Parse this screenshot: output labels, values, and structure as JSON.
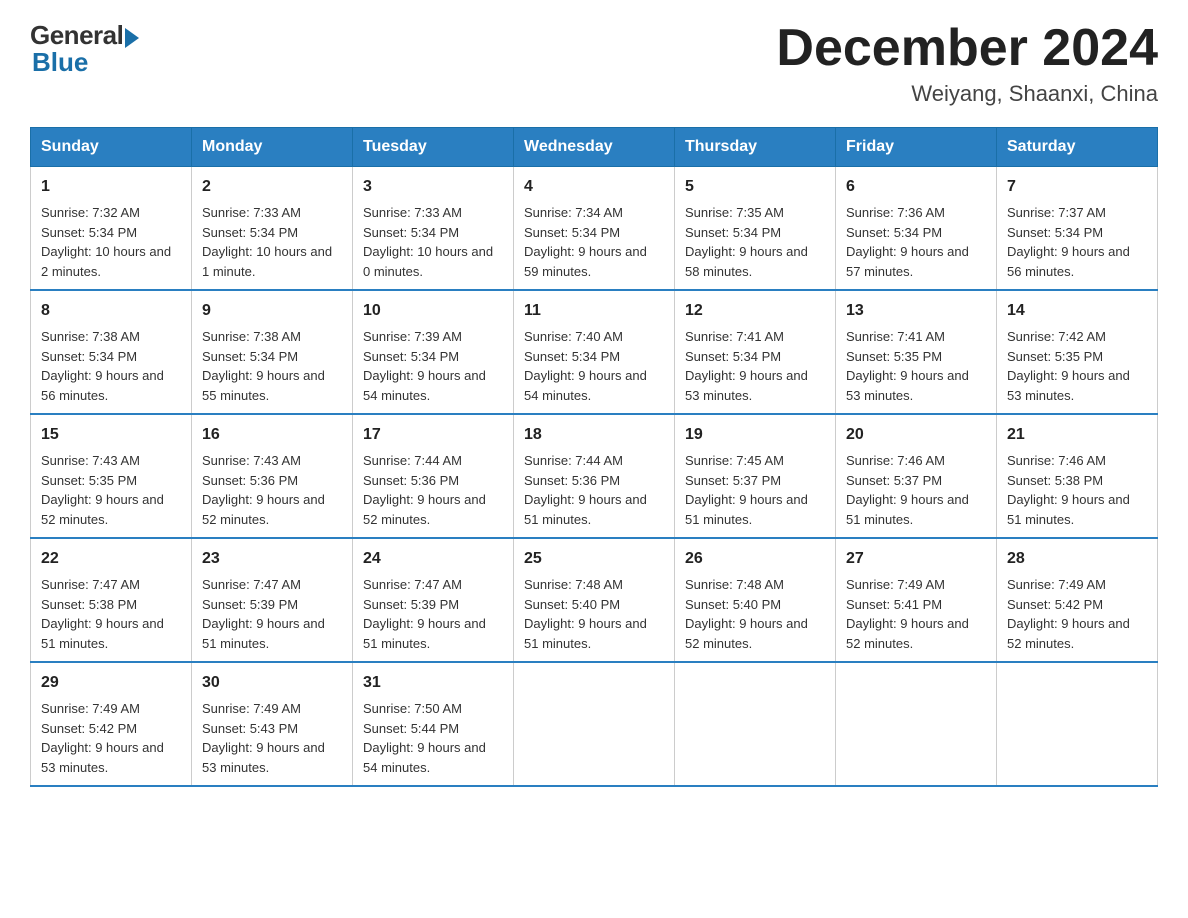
{
  "logo": {
    "general": "General",
    "blue": "Blue"
  },
  "title": "December 2024",
  "location": "Weiyang, Shaanxi, China",
  "weekdays": [
    "Sunday",
    "Monday",
    "Tuesday",
    "Wednesday",
    "Thursday",
    "Friday",
    "Saturday"
  ],
  "weeks": [
    [
      {
        "day": "1",
        "sunrise": "7:32 AM",
        "sunset": "5:34 PM",
        "daylight": "10 hours and 2 minutes."
      },
      {
        "day": "2",
        "sunrise": "7:33 AM",
        "sunset": "5:34 PM",
        "daylight": "10 hours and 1 minute."
      },
      {
        "day": "3",
        "sunrise": "7:33 AM",
        "sunset": "5:34 PM",
        "daylight": "10 hours and 0 minutes."
      },
      {
        "day": "4",
        "sunrise": "7:34 AM",
        "sunset": "5:34 PM",
        "daylight": "9 hours and 59 minutes."
      },
      {
        "day": "5",
        "sunrise": "7:35 AM",
        "sunset": "5:34 PM",
        "daylight": "9 hours and 58 minutes."
      },
      {
        "day": "6",
        "sunrise": "7:36 AM",
        "sunset": "5:34 PM",
        "daylight": "9 hours and 57 minutes."
      },
      {
        "day": "7",
        "sunrise": "7:37 AM",
        "sunset": "5:34 PM",
        "daylight": "9 hours and 56 minutes."
      }
    ],
    [
      {
        "day": "8",
        "sunrise": "7:38 AM",
        "sunset": "5:34 PM",
        "daylight": "9 hours and 56 minutes."
      },
      {
        "day": "9",
        "sunrise": "7:38 AM",
        "sunset": "5:34 PM",
        "daylight": "9 hours and 55 minutes."
      },
      {
        "day": "10",
        "sunrise": "7:39 AM",
        "sunset": "5:34 PM",
        "daylight": "9 hours and 54 minutes."
      },
      {
        "day": "11",
        "sunrise": "7:40 AM",
        "sunset": "5:34 PM",
        "daylight": "9 hours and 54 minutes."
      },
      {
        "day": "12",
        "sunrise": "7:41 AM",
        "sunset": "5:34 PM",
        "daylight": "9 hours and 53 minutes."
      },
      {
        "day": "13",
        "sunrise": "7:41 AM",
        "sunset": "5:35 PM",
        "daylight": "9 hours and 53 minutes."
      },
      {
        "day": "14",
        "sunrise": "7:42 AM",
        "sunset": "5:35 PM",
        "daylight": "9 hours and 53 minutes."
      }
    ],
    [
      {
        "day": "15",
        "sunrise": "7:43 AM",
        "sunset": "5:35 PM",
        "daylight": "9 hours and 52 minutes."
      },
      {
        "day": "16",
        "sunrise": "7:43 AM",
        "sunset": "5:36 PM",
        "daylight": "9 hours and 52 minutes."
      },
      {
        "day": "17",
        "sunrise": "7:44 AM",
        "sunset": "5:36 PM",
        "daylight": "9 hours and 52 minutes."
      },
      {
        "day": "18",
        "sunrise": "7:44 AM",
        "sunset": "5:36 PM",
        "daylight": "9 hours and 51 minutes."
      },
      {
        "day": "19",
        "sunrise": "7:45 AM",
        "sunset": "5:37 PM",
        "daylight": "9 hours and 51 minutes."
      },
      {
        "day": "20",
        "sunrise": "7:46 AM",
        "sunset": "5:37 PM",
        "daylight": "9 hours and 51 minutes."
      },
      {
        "day": "21",
        "sunrise": "7:46 AM",
        "sunset": "5:38 PM",
        "daylight": "9 hours and 51 minutes."
      }
    ],
    [
      {
        "day": "22",
        "sunrise": "7:47 AM",
        "sunset": "5:38 PM",
        "daylight": "9 hours and 51 minutes."
      },
      {
        "day": "23",
        "sunrise": "7:47 AM",
        "sunset": "5:39 PM",
        "daylight": "9 hours and 51 minutes."
      },
      {
        "day": "24",
        "sunrise": "7:47 AM",
        "sunset": "5:39 PM",
        "daylight": "9 hours and 51 minutes."
      },
      {
        "day": "25",
        "sunrise": "7:48 AM",
        "sunset": "5:40 PM",
        "daylight": "9 hours and 51 minutes."
      },
      {
        "day": "26",
        "sunrise": "7:48 AM",
        "sunset": "5:40 PM",
        "daylight": "9 hours and 52 minutes."
      },
      {
        "day": "27",
        "sunrise": "7:49 AM",
        "sunset": "5:41 PM",
        "daylight": "9 hours and 52 minutes."
      },
      {
        "day": "28",
        "sunrise": "7:49 AM",
        "sunset": "5:42 PM",
        "daylight": "9 hours and 52 minutes."
      }
    ],
    [
      {
        "day": "29",
        "sunrise": "7:49 AM",
        "sunset": "5:42 PM",
        "daylight": "9 hours and 53 minutes."
      },
      {
        "day": "30",
        "sunrise": "7:49 AM",
        "sunset": "5:43 PM",
        "daylight": "9 hours and 53 minutes."
      },
      {
        "day": "31",
        "sunrise": "7:50 AM",
        "sunset": "5:44 PM",
        "daylight": "9 hours and 54 minutes."
      },
      null,
      null,
      null,
      null
    ]
  ]
}
